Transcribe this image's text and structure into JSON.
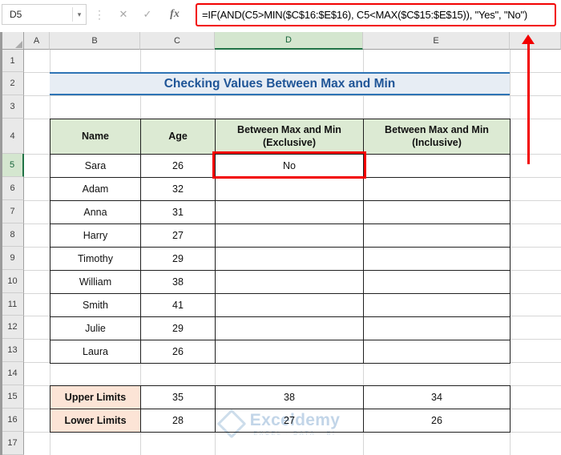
{
  "formula_bar": {
    "name_box_value": "D5",
    "separator": "⋮",
    "cancel_label": "✕",
    "enter_label": "✓",
    "fx_label": "fx",
    "formula": "=IF(AND(C5>MIN($C$16:$E$16), C5<MAX($C$15:$E$15)), \"Yes\", \"No\")"
  },
  "grid": {
    "columns": [
      "A",
      "B",
      "C",
      "D",
      "E",
      ""
    ],
    "rows": [
      "1",
      "2",
      "3",
      "4",
      "5",
      "6",
      "7",
      "8",
      "9",
      "10",
      "11",
      "12",
      "13",
      "14",
      "15",
      "16",
      "17"
    ],
    "selected_column": "D",
    "selected_row": "5"
  },
  "sheet": {
    "title": "Checking Values Between Max and Min",
    "main_table": {
      "headers": [
        "Name",
        "Age",
        "Between Max and Min (Exclusive)",
        "Between Max and Min (Inclusive)"
      ],
      "rows": [
        {
          "name": "Sara",
          "age": "26",
          "exclusive": "No",
          "inclusive": ""
        },
        {
          "name": "Adam",
          "age": "32",
          "exclusive": "",
          "inclusive": ""
        },
        {
          "name": "Anna",
          "age": "31",
          "exclusive": "",
          "inclusive": ""
        },
        {
          "name": "Harry",
          "age": "27",
          "exclusive": "",
          "inclusive": ""
        },
        {
          "name": "Timothy",
          "age": "29",
          "exclusive": "",
          "inclusive": ""
        },
        {
          "name": "William",
          "age": "38",
          "exclusive": "",
          "inclusive": ""
        },
        {
          "name": "Smith",
          "age": "41",
          "exclusive": "",
          "inclusive": ""
        },
        {
          "name": "Julie",
          "age": "29",
          "exclusive": "",
          "inclusive": ""
        },
        {
          "name": "Laura",
          "age": "26",
          "exclusive": "",
          "inclusive": ""
        }
      ]
    },
    "limits_table": {
      "rows": [
        {
          "label": "Upper Limits",
          "c": "35",
          "d": "38",
          "e": "34"
        },
        {
          "label": "Lower Limits",
          "c": "28",
          "d": "27",
          "e": "26"
        }
      ]
    }
  },
  "watermark": {
    "brand": "Exceldemy",
    "tagline": "EXCEL · DATA · BI"
  },
  "colors": {
    "annotation_red": "#f20000",
    "selection_green": "#217346",
    "selected_header_fill": "#d4e6cf",
    "table_header_green": "#dcead3",
    "limits_peach": "#fce4d6",
    "title_fill": "#e7edf4",
    "title_text": "#1f5597",
    "title_border": "#2e74b5",
    "watermark_blue": "#c2d5e8"
  }
}
